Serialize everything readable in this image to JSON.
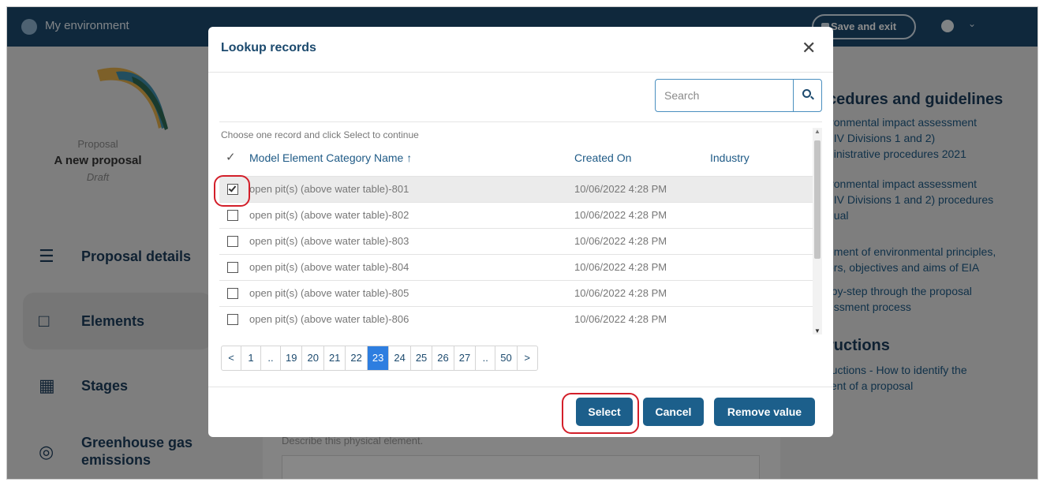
{
  "topbar": {
    "environment": "My environment",
    "save_exit": "Save and exit"
  },
  "proposal": {
    "label": "Proposal",
    "name": "A new proposal",
    "status": "Draft"
  },
  "nav": {
    "details": "Proposal details",
    "elements": "Elements",
    "stages": "Stages",
    "ghg_line1": "Greenhouse gas",
    "ghg_line2": "emissions"
  },
  "right_panel": {
    "heading1": "cedures and guidelines",
    "link1_l1": "ironmental impact assessment",
    "link1_l2": "t IV Divisions 1 and 2)",
    "link1_l3": "ninistrative procedures 2021",
    "link2_l1": "ironmental impact assessment",
    "link2_l2": "t IV Divisions 1 and 2) procedures",
    "link2_l3": "nual",
    "link3_l1": "ement of environmental principles,",
    "link3_l2": "ors, objectives and aims of EIA",
    "link4_l1": "-by-step through the proposal",
    "link4_l2": "essment process",
    "heading2": "ructions",
    "link5_l1": "ructions - How to identify the",
    "link5_l2": "tent of a proposal"
  },
  "form": {
    "hint": "Describe this physical element."
  },
  "modal": {
    "title": "Lookup records",
    "search_placeholder": "Search",
    "instruction": "Choose one record and click Select to continue",
    "columns": {
      "name": "Model Element Category Name ↑",
      "created": "Created On",
      "industry": "Industry"
    },
    "rows": [
      {
        "name": "open pit(s) (above water table)-801",
        "created": "10/06/2022 4:28 PM",
        "checked": true
      },
      {
        "name": "open pit(s) (above water table)-802",
        "created": "10/06/2022 4:28 PM",
        "checked": false
      },
      {
        "name": "open pit(s) (above water table)-803",
        "created": "10/06/2022 4:28 PM",
        "checked": false
      },
      {
        "name": "open pit(s) (above water table)-804",
        "created": "10/06/2022 4:28 PM",
        "checked": false
      },
      {
        "name": "open pit(s) (above water table)-805",
        "created": "10/06/2022 4:28 PM",
        "checked": false
      },
      {
        "name": "open pit(s) (above water table)-806",
        "created": "10/06/2022 4:28 PM",
        "checked": false
      }
    ],
    "pagination": [
      "<",
      "1",
      "..",
      "19",
      "20",
      "21",
      "22",
      "23",
      "24",
      "25",
      "26",
      "27",
      "..",
      "50",
      ">"
    ],
    "current_page": "23",
    "buttons": {
      "select": "Select",
      "cancel": "Cancel",
      "remove": "Remove value"
    }
  },
  "colors": {
    "header": "#1c4a6e",
    "button": "#1c5f8b",
    "active_page": "#2e7ee0",
    "highlight": "#d31f2a"
  }
}
